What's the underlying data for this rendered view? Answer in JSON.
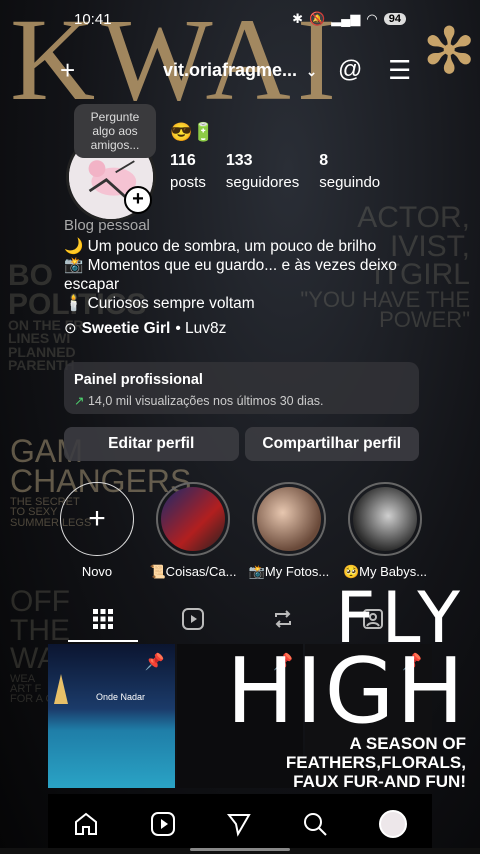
{
  "status_bar": {
    "time": "10:41",
    "battery": "94"
  },
  "wallpaper": {
    "brand": "KWAI",
    "left_texts": [
      "BO",
      "POLITICS",
      "ON THE FR",
      "LINES WI",
      "PLANNED",
      "PARENTH"
    ],
    "right_texts": [
      "ACTOR,",
      "IVIST,",
      "ITGIRL",
      "\"YOU HAVE THE",
      "POWER\""
    ],
    "gam_lines": [
      "GAM",
      "CHANGERS",
      "THE SECRET",
      "TO SEXY",
      "SUMMER LEGS"
    ],
    "off_lines": [
      "OFF",
      "THE",
      "WALL",
      "WEA",
      "ART F",
      "FOR A CAUSE"
    ],
    "fly_high": {
      "line1": "FLY",
      "line2": "HIGH",
      "sub1": "A SEASON OF",
      "sub2": "FEATHERS,FLORALS,",
      "sub3": "FAUX FUR-AND FUN!"
    }
  },
  "header": {
    "username": "vit.oriafragme..."
  },
  "profile": {
    "note": "Pergunte algo aos amigos...",
    "note_emojis": "😎🔋",
    "stats": [
      {
        "value": "116",
        "label": "posts"
      },
      {
        "value": "133",
        "label": "seguidores"
      },
      {
        "value": "8",
        "label": "seguindo"
      }
    ],
    "category": "Blog pessoal",
    "bio_lines": [
      "🌙 Um pouco de sombra, um pouco de brilho",
      "📸 Momentos que eu guardo... e às vezes deixo escapar",
      "🕯️ Curiosos sempre voltam"
    ],
    "music_title": "Sweetie Girl",
    "music_artist": "• Luv8z"
  },
  "panel": {
    "title": "Painel profissional",
    "subtitle": "14,0 mil visualizações nos últimos 30 dias."
  },
  "buttons": {
    "edit": "Editar perfil",
    "share": "Compartilhar perfil"
  },
  "highlights": [
    {
      "label": "Novo"
    },
    {
      "label": "📜Coisas/Ca..."
    },
    {
      "label": "📸My Fotos..."
    },
    {
      "label": "🥺My Babys..."
    }
  ],
  "grid_post_caption": "Onde Nadar",
  "colors": {
    "accent_gold": "#b99a6a",
    "panel_bg": "#323237",
    "positive": "#4ed36f"
  }
}
